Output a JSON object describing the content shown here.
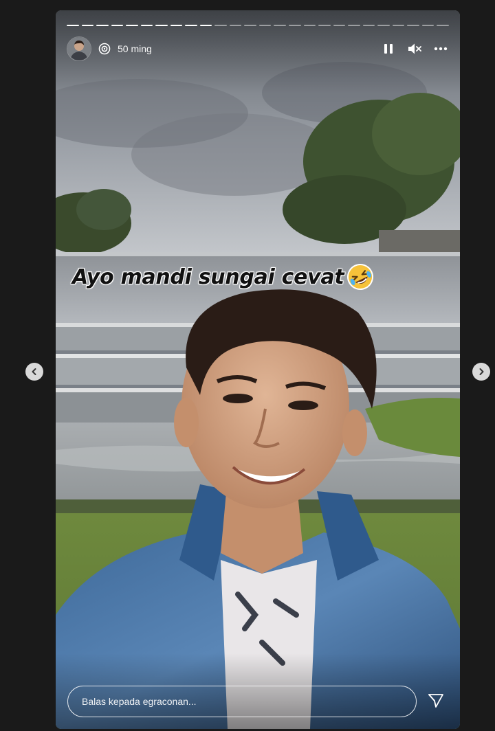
{
  "story": {
    "segments_total": 26,
    "segments_complete": 10,
    "header": {
      "avatar_icon": "profile-avatar",
      "badge_icon": "close-friends-ring-icon",
      "time_ago": "50 ming",
      "pause_icon": "pause-icon",
      "mute_icon": "muted-speaker-icon",
      "more_icon": "more-options-icon"
    },
    "caption": {
      "text": "Ayo mandi sungai cevat",
      "emoji": "rolling-on-floor-laughing-emoji"
    },
    "reply": {
      "placeholder": "Balas kepada egraconan..."
    },
    "send_icon": "send-paper-plane-icon"
  },
  "navigation": {
    "prev_icon": "chevron-left-icon",
    "next_icon": "chevron-right-icon"
  },
  "colors": {
    "page_background": "#1a1a1a",
    "nav_button": "#d9d9d9",
    "text_white": "#ffffff"
  }
}
